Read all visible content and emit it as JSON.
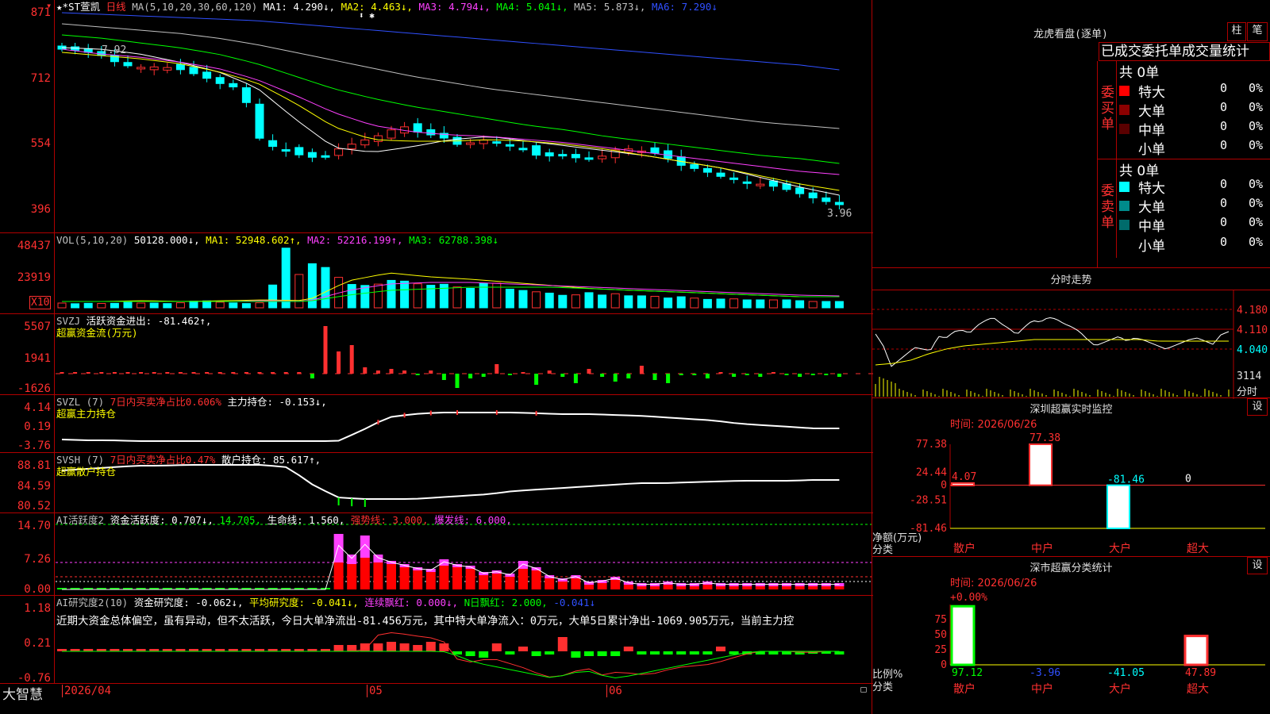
{
  "colors": {
    "up": "#ff3030",
    "down": "#00ffff",
    "border": "#b00000",
    "ma1": "#ffffff",
    "ma2": "#ffff00",
    "ma3": "#ff40ff",
    "ma4": "#00ff00",
    "ma5": "#c0c0c0",
    "ma6": "#3050ff"
  },
  "kline": {
    "stock": "★*ST萱凯",
    "period": "日线",
    "ma_params": "MA(5,10,20,30,60,120)",
    "ma1": "MA1: 4.290↓,",
    "ma2": "MA2: 4.463↓,",
    "ma3": "MA3: 4.794↓,",
    "ma4": "MA4: 5.041↓,",
    "ma5": "MA5: 5.873↓,",
    "ma6": "MA6: 7.290↓",
    "yticks": [
      "871",
      "712",
      "554",
      "396"
    ],
    "high_label": "7.92",
    "low_label": "3.96",
    "markers": "⬍ ✱"
  },
  "vol": {
    "name": "VOL(5,10,20)",
    "value": "50128.000↓,",
    "ma1": "MA1: 52948.602↑,",
    "ma2": "MA2: 52216.199↑,",
    "ma3": "MA3: 62788.398↓",
    "yticks": [
      "48437",
      "23919"
    ],
    "unit": "X10"
  },
  "svzj": {
    "name": "SVZJ",
    "label": "活跃资金进出:",
    "value": "-81.462↑,",
    "line2": "超赢资金流(万元)",
    "yticks": [
      "5507",
      "1941",
      "-1626"
    ]
  },
  "svzl": {
    "name": "SVZL (7)",
    "label1": "7日内买卖净占比0.606%",
    "label2": "主力持仓:",
    "value": "-0.153↓,",
    "line2": "超赢主力持仓",
    "yticks": [
      "4.14",
      "0.19",
      "-3.76"
    ]
  },
  "svsh": {
    "name": "SVSH (7)",
    "label1": "7日内买卖净占比0.47%",
    "label2": "散户持仓:",
    "value": "85.617↑,",
    "line2": "超赢散户持仓",
    "yticks": [
      "88.81",
      "84.59",
      "80.52"
    ]
  },
  "ai_active": {
    "name": "AI活跃度2",
    "label": "资金活跃度:",
    "v1": "0.707↓,",
    "v2": "14.705,",
    "life": "生命线:",
    "v3": "1.560,",
    "strong": "强势线: 3.000,",
    "burst": "爆发线: 6.000,",
    "yticks": [
      "14.70",
      "7.26",
      "0.00"
    ]
  },
  "ai_research": {
    "name": "AI研究度2(10)",
    "label": "资金研究度:",
    "v1": "-0.062↓,",
    "avg": "平均研究度: -0.041↓,",
    "cont": "连续飘红: 0.000↓,",
    "n": "N日飘红: 2.000,",
    "v2": "-0.041↓",
    "text": "近期大资金总体偏空，虽有异动，但不太活跃，今日大单净流出-81.456万元，其中特大单净流入：0万元，大单5日累计净出-1069.905万元，当前主力控",
    "yticks": [
      "1.18",
      "0.21",
      "-0.76"
    ]
  },
  "xaxis": {
    "brand": "大智慧",
    "d1": "2026/04",
    "d2": "05",
    "d3": "06"
  },
  "dragon": {
    "title": "龙虎看盘(逐单)",
    "btn1": "柱",
    "btn2": "笔",
    "subtitle": "已成交委托单成交量统计",
    "buy_label": "委买单",
    "sell_label": "委卖单",
    "buy_total": "共 0单",
    "sell_total": "共 0单",
    "rows": [
      "特大",
      "大单",
      "中单",
      "小单"
    ],
    "count": "0",
    "pct": "0%"
  },
  "minute": {
    "title": "分时走势",
    "p1": "4.180",
    "p2": "4.110",
    "p3": "4.040",
    "vol": "3114",
    "unit": "分时"
  },
  "sz_monitor": {
    "title": "深圳超赢实时监控",
    "btn": "设",
    "time": "时间: 2026/06/26",
    "yticks": [
      "77.38",
      "24.44",
      "0",
      "-28.51",
      "-81.46"
    ],
    "unit1": "净额(万元)",
    "unit2": "分类",
    "cats": [
      "散户",
      "中户",
      "大户",
      "超大"
    ],
    "chart_data": {
      "type": "bar",
      "categories": [
        "散户",
        "中户",
        "大户",
        "超大"
      ],
      "values": [
        4.07,
        77.38,
        -81.46,
        0
      ],
      "ylim": [
        -81.46,
        77.38
      ]
    },
    "labels": [
      "4.07",
      "77.38",
      "-81.46",
      "0"
    ]
  },
  "sz_stats": {
    "title": "深市超赢分类统计",
    "btn": "设",
    "time": "时间: 2026/06/26",
    "top": "+0.00%",
    "yticks": [
      "75",
      "50",
      "25",
      "0"
    ],
    "unit1": "比例%",
    "unit2": "分类",
    "cats": [
      "散户",
      "中户",
      "大户",
      "超大"
    ],
    "chart_data": {
      "type": "bar",
      "categories": [
        "散户",
        "中户",
        "大户",
        "超大"
      ],
      "values": [
        97.12,
        -3.96,
        -41.05,
        47.89
      ]
    },
    "labels": [
      "97.12",
      "-3.96",
      "-41.05",
      "47.89"
    ]
  }
}
